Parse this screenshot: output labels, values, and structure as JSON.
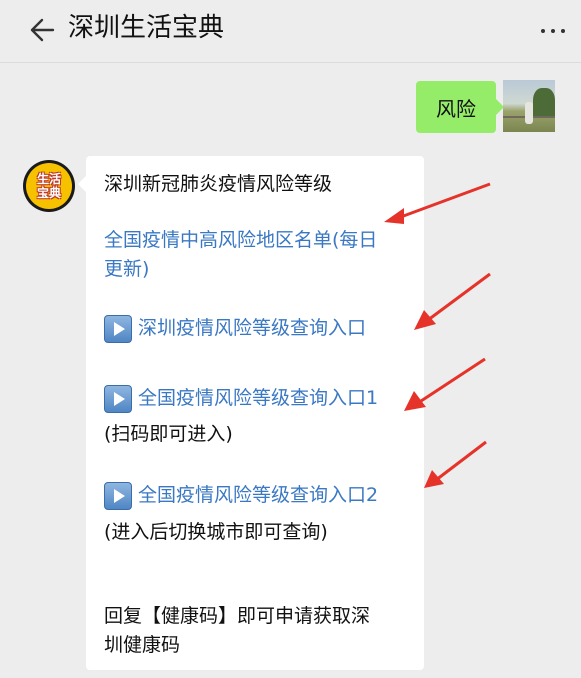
{
  "header": {
    "title": "深圳生活宝典",
    "back_icon": "back-arrow-icon",
    "more_icon": "more-dots-icon"
  },
  "outgoing": {
    "text": "风险",
    "bubble_color": "#95ec69"
  },
  "incoming": {
    "avatar_text_line1": "生活",
    "avatar_text_line2": "宝典",
    "title": "深圳新冠肺炎疫情风险等级",
    "link1": "全国疫情中高风险地区名单(每日",
    "link1_cont": "更新)",
    "link2": "深圳疫情风险等级查询入口",
    "link3": "全国疫情风险等级查询入口1",
    "note3": "(扫码即可进入)",
    "link4": "全国疫情风险等级查询入口2",
    "note4": "(进入后切换城市即可查询)",
    "footer_line1": "回复【健康码】即可申请获取深",
    "footer_line2": "圳健康码",
    "link_color": "#3a78c3",
    "arrow_color": "#e5332a"
  }
}
